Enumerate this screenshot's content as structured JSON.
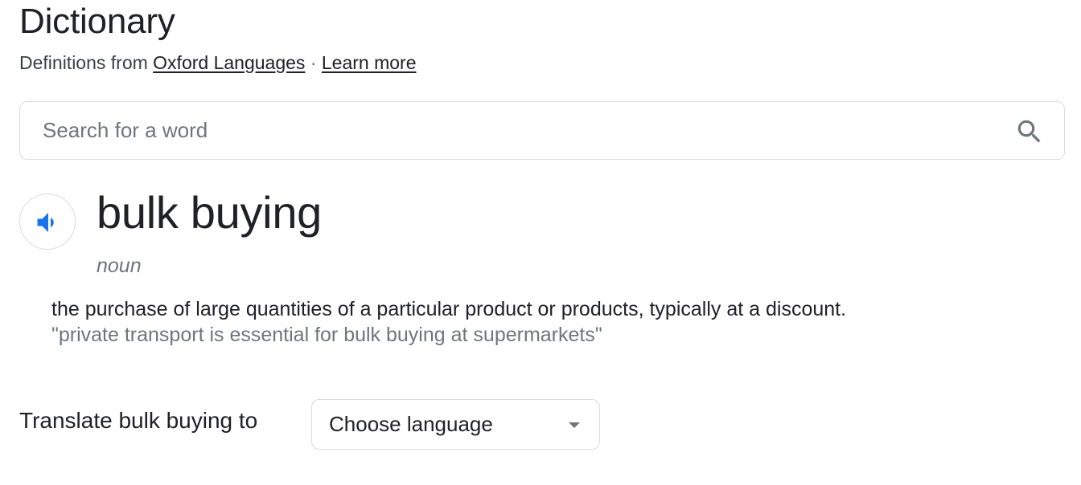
{
  "header": {
    "title": "Dictionary",
    "source_prefix": "Definitions from",
    "source_link": "Oxford Languages",
    "separator": "·",
    "learn_more": "Learn more"
  },
  "search": {
    "placeholder": "Search for a word",
    "value": "",
    "icon": "search-icon"
  },
  "entry": {
    "audio_icon": "speaker-icon",
    "word": "bulk buying",
    "part_of_speech": "noun",
    "definition": "the purchase of large quantities of a particular product or products, typically at a discount.",
    "example": "\"private transport is essential for bulk buying at supermarkets\""
  },
  "translate": {
    "label": "Translate bulk buying to",
    "select_value": "Choose language",
    "select_icon": "dropdown-triangle-icon"
  },
  "colors": {
    "text": "#202124",
    "secondary": "#70757a",
    "border": "#dadce0",
    "accent_blue": "#1a73e8"
  }
}
